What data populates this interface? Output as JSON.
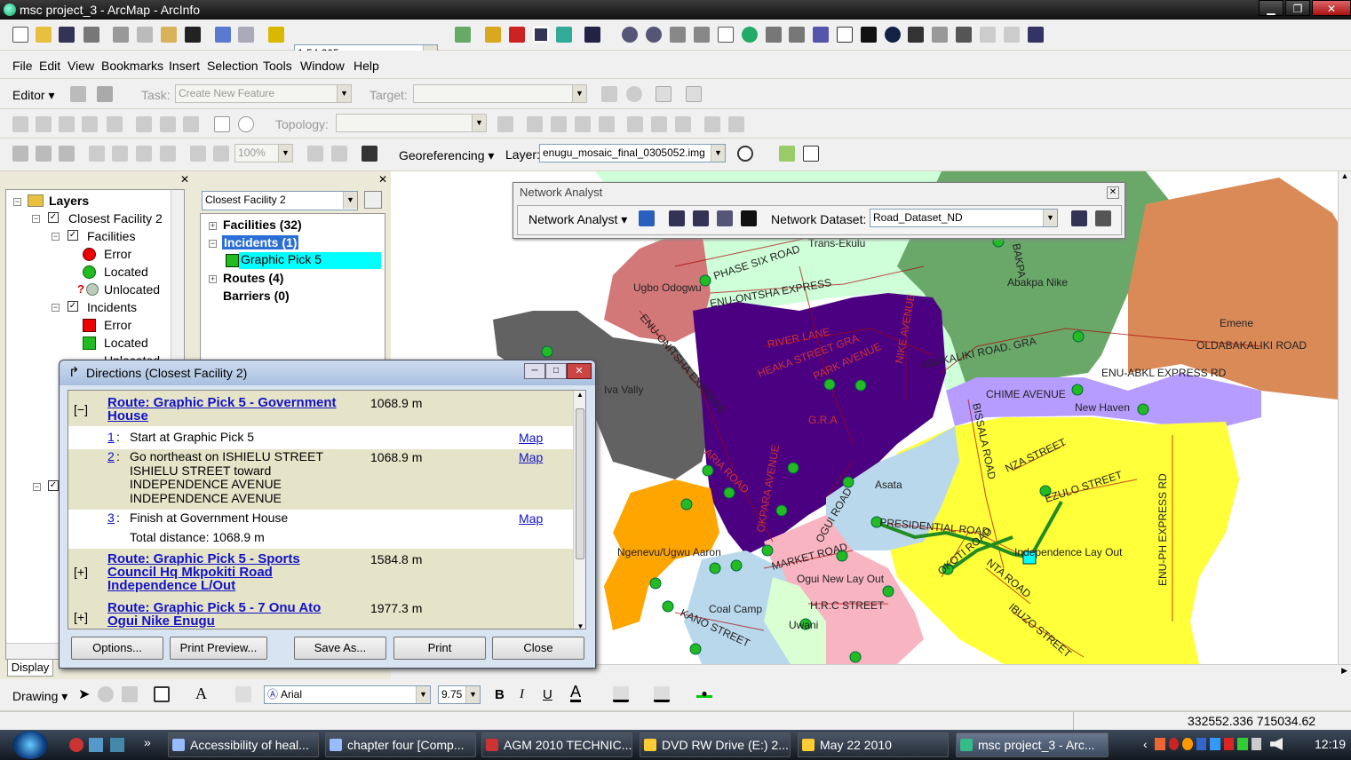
{
  "window": {
    "title": "msc project_3 - ArcMap - ArcInfo",
    "minimize": "▁",
    "maximize": "❐",
    "close": "✕"
  },
  "toolbar": {
    "scale": "1:54,205"
  },
  "menu": [
    "File",
    "Edit",
    "View",
    "Bookmarks",
    "Insert",
    "Selection",
    "Tools",
    "Window",
    "Help"
  ],
  "editor": {
    "label": "Editor",
    "task_label": "Task:",
    "task_value": "Create New Feature",
    "target_label": "Target:"
  },
  "topology": {
    "label": "Topology:"
  },
  "georef": {
    "zoom": "100%",
    "menu": "Georeferencing",
    "layer_label": "Layer:",
    "layer_value": "enugu_mosaic_final_0305052.img"
  },
  "toc": {
    "title": "Layers",
    "items": {
      "closest_facility": "Closest Facility 2",
      "facilities": "Facilities",
      "fac_error": "Error",
      "fac_located": "Located",
      "fac_unlocated": "Unlocated",
      "incidents": "Incidents",
      "inc_error": "Error",
      "inc_located": "Located",
      "inc_unlocated": "Unlocated"
    },
    "tab_display": "Display"
  },
  "na_window": {
    "combo": "Closest Facility 2",
    "facilities": "Facilities (32)",
    "incidents": "Incidents (1)",
    "graphic_pick": "Graphic Pick 5",
    "routes": "Routes (4)",
    "barriers": "Barriers (0)"
  },
  "network_analyst": {
    "title": "Network Analyst",
    "menu": "Network Analyst",
    "dataset_label": "Network Dataset:",
    "dataset_value": "Road_Dataset_ND"
  },
  "directions": {
    "title": "Directions (Closest Facility 2)",
    "route1": {
      "toggle": "[−]",
      "name": "Route: Graphic Pick 5 - Government House",
      "distance": "1068.9 m"
    },
    "steps": [
      {
        "num": "1",
        "text": "Start at Graphic Pick 5",
        "link": "Map"
      },
      {
        "num": "2",
        "text": "Go northeast on ISHIELU STREET ISHIELU STREET toward INDEPENDENCE AVENUE INDEPENDENCE AVENUE",
        "distance": "1068.9 m",
        "link": "Map"
      },
      {
        "num": "3",
        "text": "Finish at Government House",
        "link": "Map"
      }
    ],
    "total": "Total distance: 1068.9 m",
    "route2": {
      "toggle": "[+]",
      "name": "Route: Graphic Pick 5 - Sports Council Hq Mkpokiti Road Independence L/Out",
      "distance": "1584.8 m"
    },
    "route3": {
      "toggle": "[+]",
      "name": "Route: Graphic Pick 5 - 7 Onu Ato Ogui Nike Enugu",
      "distance": "1977.3 m"
    },
    "buttons": {
      "options": "Options...",
      "preview": "Print Preview...",
      "save": "Save As...",
      "print": "Print",
      "close": "Close"
    }
  },
  "map_labels": {
    "transekulu": "Trans-Ekulu",
    "phase6": "PHASE SIX ROAD",
    "ugbo": "Ugbo Odogwu",
    "onitsha": "ENU-ONTSHA EXPRESS",
    "enu_oni": "ENU-ONITSHA EXPRESS",
    "abakpa": "Abakpa Nike",
    "bakpa": "BAKPA",
    "emene": "Emene",
    "oldabak": "OLDABAKALIKI ROAD",
    "enuabkl": "ENU-ABKL EXPRESS RD",
    "river": "RIVER LANE",
    "heaka": "HEAKA STREET GRA",
    "park": "PARK AVENUE",
    "nike": "NIKE AVENUE",
    "abakaliki": "ABAKALIKI ROAD. GRA",
    "chime": "CHIME AVENUE",
    "newhaven": "New Haven",
    "ivavally": "Iva Vally",
    "gra": "G.R.A",
    "aria": "ARIA ROAD",
    "bissala": "BISSALA ROAD",
    "nza": "NZA STREET",
    "zulo": "EZULO STREET",
    "asata": "Asata",
    "presidential": "PRESIDENTIAL ROAD",
    "enuph": "ENU-PH EXPRESS RD",
    "indep": "Independence Lay Out",
    "okpara": "OKPARA AVENUE",
    "ogui": "OGUI ROAD",
    "ngenevu": "Ngenevu/Ugwu Aaron",
    "market": "MARKET ROAD",
    "oguinew": "Ogui New Lay Out",
    "okoti": "OKOTI ROAD",
    "nta": "NTA ROAD",
    "coal": "Coal Camp",
    "hrc": "H.R.C STREET",
    "kano": "KANO STREET",
    "uwani": "Uwani",
    "ibuzo": "IBUZO STREET"
  },
  "drawing": {
    "label": "Drawing",
    "font": "Arial",
    "size": "9.75",
    "bold": "B",
    "italic": "I",
    "underline": "U",
    "font_color": "A"
  },
  "status": {
    "coords": "332552.336  715034.62 Meters"
  },
  "taskbar": {
    "tasks": [
      "Accessibility of heal...",
      "chapter four [Comp...",
      "AGM 2010 TECHNIC...",
      "DVD RW Drive (E:) 2...",
      "May 22 2010",
      "msc project_3 - Arc..."
    ],
    "clock": "12:19",
    "overflow": "»"
  },
  "colors": {
    "purple": "#4b0082",
    "yellow": "#ffff3a",
    "route": "#228b22",
    "incident": "#00ffff",
    "facility": "#22bb22"
  }
}
